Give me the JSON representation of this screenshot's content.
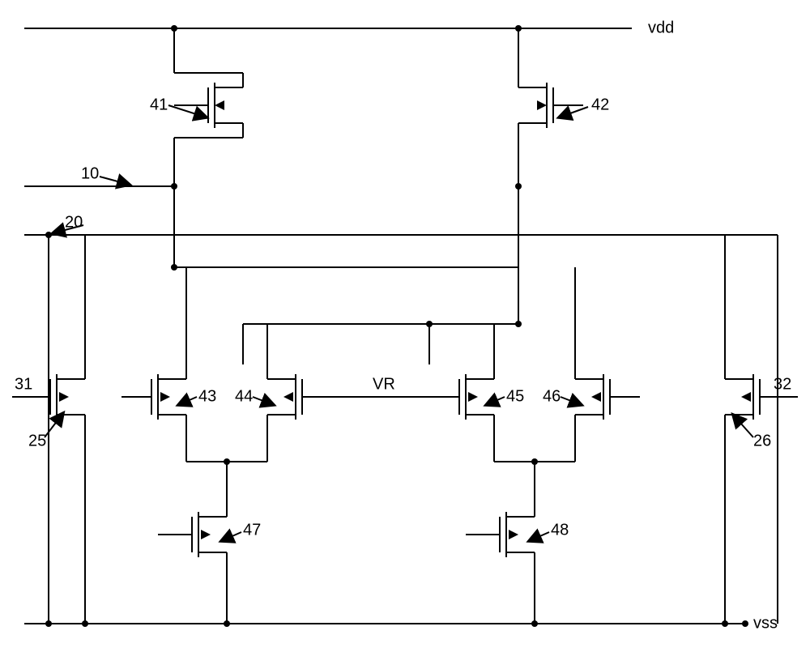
{
  "rails": {
    "vdd": "vdd",
    "vss": "vss"
  },
  "signals": {
    "n10": "10",
    "n20": "20",
    "n31": "31",
    "n32": "32",
    "n25": "25",
    "n26": "26",
    "vr": "VR"
  },
  "transistors": {
    "q41": "41",
    "q42": "42",
    "q43": "43",
    "q44": "44",
    "q45": "45",
    "q46": "46",
    "q47": "47",
    "q48": "48"
  }
}
